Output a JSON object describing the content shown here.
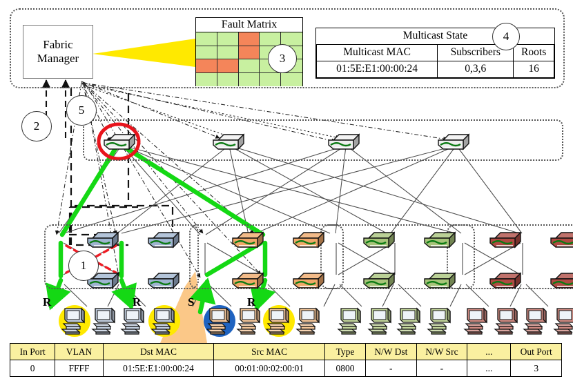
{
  "control_plane": {
    "fabric_manager": {
      "label": "Fabric\nManager",
      "name": "fabric-manager"
    },
    "fault_matrix": {
      "title": "Fault Matrix",
      "rows": 4,
      "cols": 5,
      "ok_color": "#c8f0a0",
      "fault_color": "#f4855a",
      "cells": [
        [
          "ok",
          "ok",
          "fault",
          "ok",
          "ok"
        ],
        [
          "ok",
          "ok",
          "fault",
          "ok",
          "ok"
        ],
        [
          "fault",
          "fault",
          "ok",
          "ok",
          "ok"
        ],
        [
          "ok",
          "ok",
          "ok",
          "ok",
          "ok"
        ]
      ]
    },
    "multicast_state": {
      "title": "Multicast State",
      "headers": [
        "Multicast MAC",
        "Subscribers",
        "Roots"
      ],
      "row": [
        "01:5E:E1:00:00:24",
        "0,3,6",
        "16"
      ]
    }
  },
  "callouts": [
    {
      "id": "1",
      "label": "1"
    },
    {
      "id": "2",
      "label": "2"
    },
    {
      "id": "3",
      "label": "3"
    },
    {
      "id": "4",
      "label": "4"
    },
    {
      "id": "5",
      "label": "5"
    }
  ],
  "topology": {
    "core_layer": {
      "name": "core-switch-row",
      "count": 4,
      "color": "#efefef"
    },
    "pods": [
      {
        "name": "pod-blue",
        "color": "#9fb4d0",
        "host_color": "#c3cfe0",
        "switches": 4,
        "hosts": 4,
        "host_marks": [
          "R",
          "",
          "",
          "R"
        ],
        "highlight": [
          "yellow",
          "",
          "",
          "yellow"
        ]
      },
      {
        "name": "pod-orange",
        "color": "#f0a868",
        "host_color": "#f5c79a",
        "switches": 4,
        "hosts": 4,
        "host_marks": [
          "S",
          "",
          "R",
          ""
        ],
        "highlight": [
          "blue",
          "",
          "yellow",
          ""
        ]
      },
      {
        "name": "pod-green",
        "color": "#a8c47a",
        "host_color": "#c3d69b",
        "switches": 4,
        "hosts": 4,
        "host_marks": [
          "",
          "",
          "",
          ""
        ],
        "highlight": [
          "",
          "",
          "",
          ""
        ]
      },
      {
        "name": "pod-red",
        "color": "#b04a42",
        "host_color": "#d08a82",
        "switches": 4,
        "hosts": 4,
        "host_marks": [
          "",
          "",
          "",
          ""
        ],
        "highlight": [
          "",
          "",
          "",
          ""
        ]
      }
    ],
    "fault_link_color": "#ee1c25",
    "multicast_path_color": "#14d814",
    "failed_node_ring_color": "#e8141c"
  },
  "flow_table": {
    "headers": [
      "In Port",
      "VLAN",
      "Dst MAC",
      "Src MAC",
      "Type",
      "N/W Dst",
      "N/W Src",
      "...",
      "Out Port"
    ],
    "row": [
      "0",
      "FFFF",
      "01:5E:E1:00:00:24",
      "00:01:00:02:00:01",
      "0800",
      "-",
      "-",
      "...",
      "3"
    ],
    "header_bg": "#FAF0A0"
  }
}
